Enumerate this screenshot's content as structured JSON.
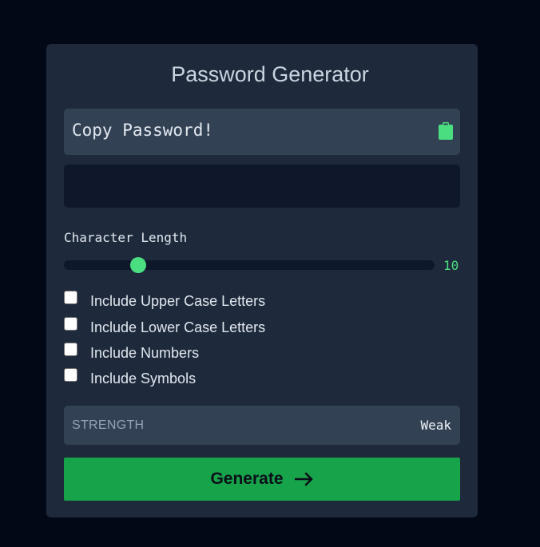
{
  "app": {
    "title": "Password Generator"
  },
  "copy": {
    "text": "Copy Password!",
    "icon": "clipboard-icon"
  },
  "password": {
    "value": ""
  },
  "length": {
    "label": "Character Length",
    "value": "10",
    "min": 0,
    "max": 60
  },
  "options": [
    {
      "label": "Include Upper Case Letters",
      "checked": false
    },
    {
      "label": "Include Lower Case Letters",
      "checked": false
    },
    {
      "label": "Include Numbers",
      "checked": false
    },
    {
      "label": "Include Symbols",
      "checked": false
    }
  ],
  "strength": {
    "label": "STRENGTH",
    "value": "Weak"
  },
  "generate": {
    "label": "Generate",
    "icon": "arrow-right-icon"
  },
  "colors": {
    "background": "#030817",
    "card": "#1e293b",
    "accent": "#4ade80",
    "button": "#16a34a"
  }
}
